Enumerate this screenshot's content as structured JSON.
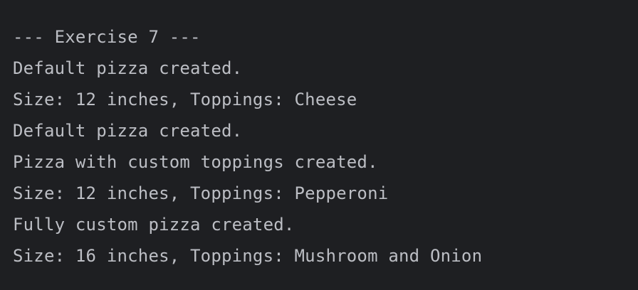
{
  "console": {
    "lines": [
      "--- Exercise 7 ---",
      "Default pizza created.",
      "Size: 12 inches, Toppings: Cheese",
      "Default pizza created.",
      "Pizza with custom toppings created.",
      "Size: 12 inches, Toppings: Pepperoni",
      "Fully custom pizza created.",
      "Size: 16 inches, Toppings: Mushroom and Onion"
    ]
  },
  "colors": {
    "background": "#1e1f22",
    "text": "#bcbec4"
  }
}
